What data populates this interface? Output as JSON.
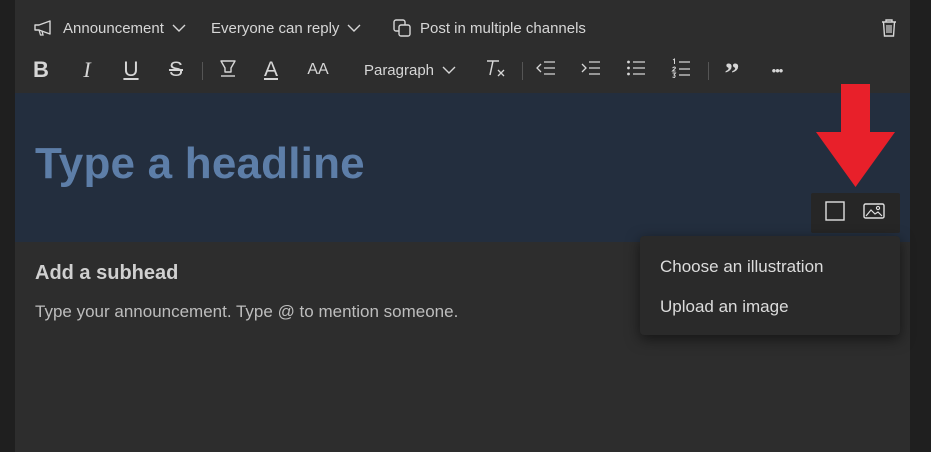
{
  "toolbar": {
    "announcement_label": "Announcement",
    "reply_label": "Everyone can reply",
    "multi_channel_label": "Post in multiple channels"
  },
  "format": {
    "bold_glyph": "B",
    "italic_glyph": "I",
    "underline_glyph": "U",
    "strike_glyph": "S",
    "font_color_glyph": "A",
    "font_size_glyph": "AA",
    "paragraph_label": "Paragraph",
    "quote_glyph": "”",
    "more_glyph": "•••"
  },
  "banner": {
    "headline_placeholder": "Type a headline"
  },
  "content": {
    "subhead_placeholder": "Add a subhead",
    "body_placeholder": "Type your announcement. Type @ to mention someone."
  },
  "image_menu": {
    "items": [
      {
        "label": "Choose an illustration"
      },
      {
        "label": "Upload an image"
      }
    ]
  },
  "colors": {
    "panel_bg": "#2d2d2d",
    "banner_bg": "#232e3e",
    "headline": "#5d7ea8",
    "callout_arrow": "#e8202a"
  },
  "icons": [
    "megaphone-icon",
    "chevron-down-icon",
    "copy-channels-icon",
    "trash-icon",
    "highlighter-icon",
    "clear-format-icon",
    "decrease-indent-icon",
    "increase-indent-icon",
    "bulleted-list-icon",
    "numbered-list-icon",
    "banner-color-icon",
    "banner-image-icon"
  ]
}
